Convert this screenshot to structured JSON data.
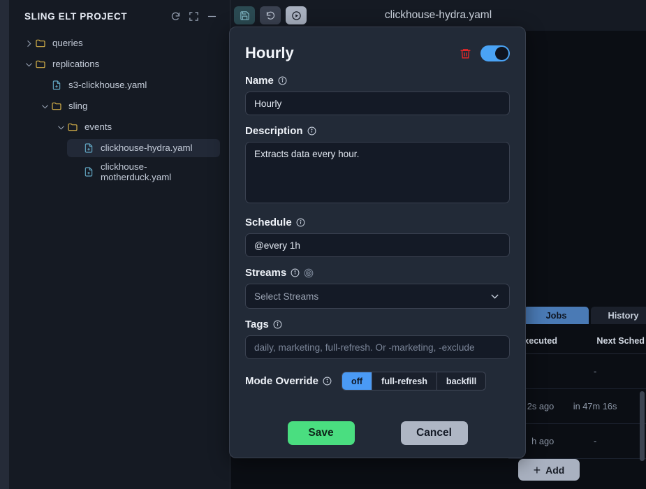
{
  "sidebar": {
    "title": "SLING ELT PROJECT",
    "header_icons": [
      {
        "name": "refresh-icon",
        "glyph": "refresh"
      },
      {
        "name": "expand-icon",
        "glyph": "expand"
      },
      {
        "name": "collapse-icon",
        "glyph": "minus"
      }
    ],
    "tree": [
      {
        "label": "queries",
        "type": "folder",
        "chevron": "right",
        "indent": 0,
        "selected": false
      },
      {
        "label": "replications",
        "type": "folder",
        "chevron": "down",
        "indent": 0,
        "selected": false
      },
      {
        "label": "s3-clickhouse.yaml",
        "type": "file",
        "chevron": "none",
        "indent": 1,
        "selected": false
      },
      {
        "label": "sling",
        "type": "folder",
        "chevron": "down",
        "indent": 1,
        "selected": false
      },
      {
        "label": "events",
        "type": "folder",
        "chevron": "down",
        "indent": 2,
        "selected": false
      },
      {
        "label": "clickhouse-hydra.yaml",
        "type": "file",
        "chevron": "none",
        "indent": 3,
        "selected": true
      },
      {
        "label": "clickhouse-\nmotherduck.yaml",
        "type": "file",
        "chevron": "none",
        "indent": 3,
        "selected": false
      }
    ]
  },
  "topbar": {
    "filename": "clickhouse-hydra.yaml",
    "buttons": [
      {
        "name": "save-file-button",
        "icon": "floppy-disk-icon"
      },
      {
        "name": "revert-button",
        "icon": "undo-icon"
      },
      {
        "name": "run-button",
        "icon": "play-circle-icon"
      }
    ]
  },
  "background": {
    "tabs": [
      {
        "label": "Jobs",
        "active": true
      },
      {
        "label": "History",
        "active": false
      }
    ],
    "table": {
      "columns": [
        "Executed",
        "Next Sched"
      ],
      "rows": [
        {
          "executed": "",
          "next": "-"
        },
        {
          "executed": "2s ago",
          "next": "in 47m 16s"
        },
        {
          "executed": "h ago",
          "next": "-"
        }
      ]
    },
    "add_button": "Add",
    "add_icon": "plus-icon"
  },
  "modal": {
    "title": "Hourly",
    "delete_icon": "trash-icon",
    "enabled_toggle": true,
    "fields": {
      "name": {
        "label": "Name",
        "info_icon": "info-icon",
        "value": "Hourly",
        "placeholder": ""
      },
      "description": {
        "label": "Description",
        "info_icon": "info-icon",
        "value": "Extracts data every hour.",
        "placeholder": ""
      },
      "schedule": {
        "label": "Schedule",
        "info_icon": "info-icon",
        "value": "@every 1h",
        "placeholder": ""
      },
      "streams": {
        "label": "Streams",
        "info_icon": "info-icon",
        "extra_icon": "target-icon",
        "placeholder": "Select Streams",
        "chevron_icon": "chevron-down-icon"
      },
      "tags": {
        "label": "Tags",
        "info_icon": "info-icon",
        "value": "",
        "placeholder": "daily, marketing, full-refresh. Or -marketing, -exclude"
      },
      "mode_override": {
        "label": "Mode Override",
        "info_icon": "info-icon",
        "options": [
          {
            "label": "off",
            "active": true
          },
          {
            "label": "full-refresh",
            "active": false
          },
          {
            "label": "backfill",
            "active": false
          }
        ]
      }
    },
    "actions": {
      "save": "Save",
      "cancel": "Cancel"
    }
  },
  "colors": {
    "accent_blue": "#4a9af5",
    "save_green": "#4ade80",
    "danger_red": "#e0282a",
    "folder_yellow": "#d8b34a",
    "file_blue": "#63a8c4"
  }
}
